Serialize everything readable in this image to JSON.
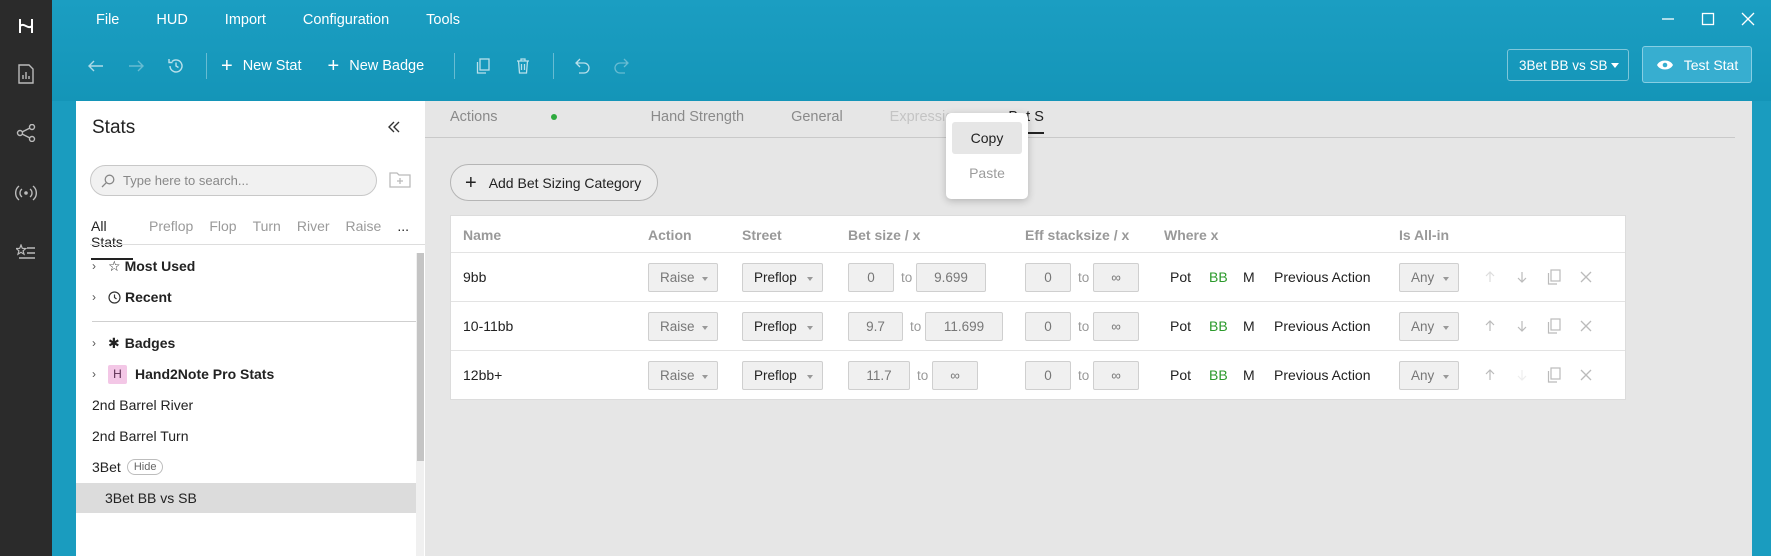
{
  "app": {
    "menu": [
      "File",
      "HUD",
      "Import",
      "Configuration",
      "Tools"
    ]
  },
  "toolbar": {
    "new_stat": "New Stat",
    "new_badge": "New Badge",
    "stat_select": "3Bet BB vs SB",
    "test_stat": "Test Stat"
  },
  "stats_panel": {
    "title": "Stats",
    "search_placeholder": "Type here to search...",
    "tabs": [
      "All Stats",
      "Preflop",
      "Flop",
      "Turn",
      "River",
      "Raise",
      "..."
    ],
    "tree": {
      "most_used": "Most Used",
      "recent": "Recent",
      "badges": "Badges",
      "h2n_badge": "H",
      "h2n_pro": "Hand2Note Pro Stats",
      "item1": "2nd Barrel River",
      "item2": "2nd Barrel Turn",
      "item3": "3Bet",
      "hide": "Hide",
      "item4": "3Bet BB vs SB"
    }
  },
  "main": {
    "tabs": [
      "Actions",
      "Hand Strength",
      "General",
      "Expression",
      "Bet Si"
    ],
    "add_category": "Add Bet Sizing Category",
    "table": {
      "headers": [
        "Name",
        "Action",
        "Street",
        "Bet size / x",
        "Eff stacksize / x",
        "Where x",
        "Is All-in"
      ],
      "rows": [
        {
          "name": "9bb",
          "action": "Raise",
          "street": "Preflop",
          "bet_from": "0",
          "bet_to": "9.699",
          "eff_from": "0",
          "eff_to": "∞",
          "to": "to",
          "pot": "Pot",
          "bb": "BB",
          "m": "M",
          "prev": "Previous Action",
          "allin": "Any"
        },
        {
          "name": "10-11bb",
          "action": "Raise",
          "street": "Preflop",
          "bet_from": "9.7",
          "bet_to": "11.699",
          "eff_from": "0",
          "eff_to": "∞",
          "to": "to",
          "pot": "Pot",
          "bb": "BB",
          "m": "M",
          "prev": "Previous Action",
          "allin": "Any"
        },
        {
          "name": "12bb+",
          "action": "Raise",
          "street": "Preflop",
          "bet_from": "11.7",
          "bet_to": "∞",
          "eff_from": "0",
          "eff_to": "∞",
          "to": "to",
          "pot": "Pot",
          "bb": "BB",
          "m": "M",
          "prev": "Previous Action",
          "allin": "Any"
        }
      ]
    }
  },
  "context_menu": {
    "copy": "Copy",
    "paste": "Paste"
  },
  "colors": {
    "accent": "#1a9cbf",
    "rail": "#2b2b2b",
    "bb_green": "#2b9a2b",
    "active_dot": "#2eaa3e"
  }
}
